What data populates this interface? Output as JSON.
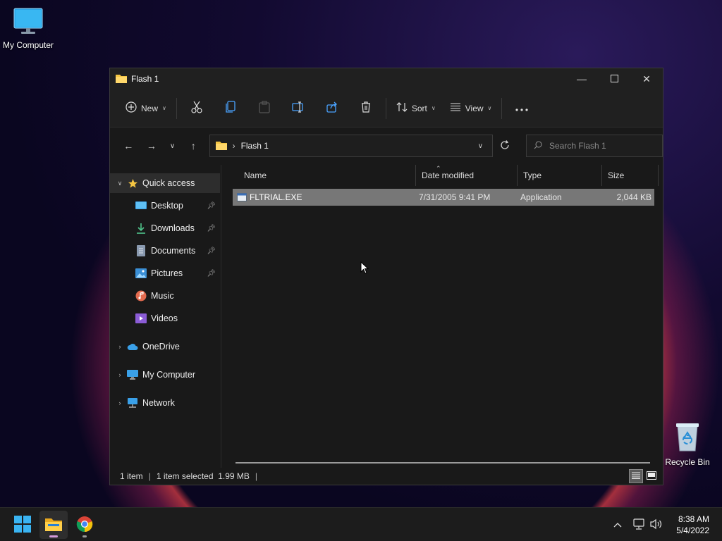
{
  "desktop": {
    "my_computer_label": "My Computer",
    "recycle_bin_label": "Recycle Bin"
  },
  "window": {
    "title": "Flash 1",
    "toolbar": {
      "new_label": "New",
      "sort_label": "Sort",
      "view_label": "View",
      "more_label": "..."
    },
    "address": {
      "crumb": "Flash 1",
      "search_placeholder": "Search Flash 1"
    },
    "nav": {
      "quick_access": "Quick access",
      "items": [
        {
          "label": "Desktop",
          "pinned": true
        },
        {
          "label": "Downloads",
          "pinned": true
        },
        {
          "label": "Documents",
          "pinned": true
        },
        {
          "label": "Pictures",
          "pinned": true
        },
        {
          "label": "Music",
          "pinned": false
        },
        {
          "label": "Videos",
          "pinned": false
        }
      ],
      "onedrive": "OneDrive",
      "my_computer": "My Computer",
      "network": "Network"
    },
    "columns": {
      "name": "Name",
      "date_modified": "Date modified",
      "type": "Type",
      "size": "Size"
    },
    "files": [
      {
        "name": "FLTRIAL.EXE",
        "date_modified": "7/31/2005 9:41 PM",
        "type": "Application",
        "size": "2,044 KB",
        "selected": true
      }
    ],
    "status": {
      "item_count": "1 item",
      "selection": "1 item selected  1.99 MB"
    }
  },
  "taskbar": {
    "time": "8:38 AM",
    "date": "5/4/2022"
  },
  "colors": {
    "window_bg": "#191919",
    "selected_row": "#777777",
    "accent_folder": "#f4c542"
  }
}
